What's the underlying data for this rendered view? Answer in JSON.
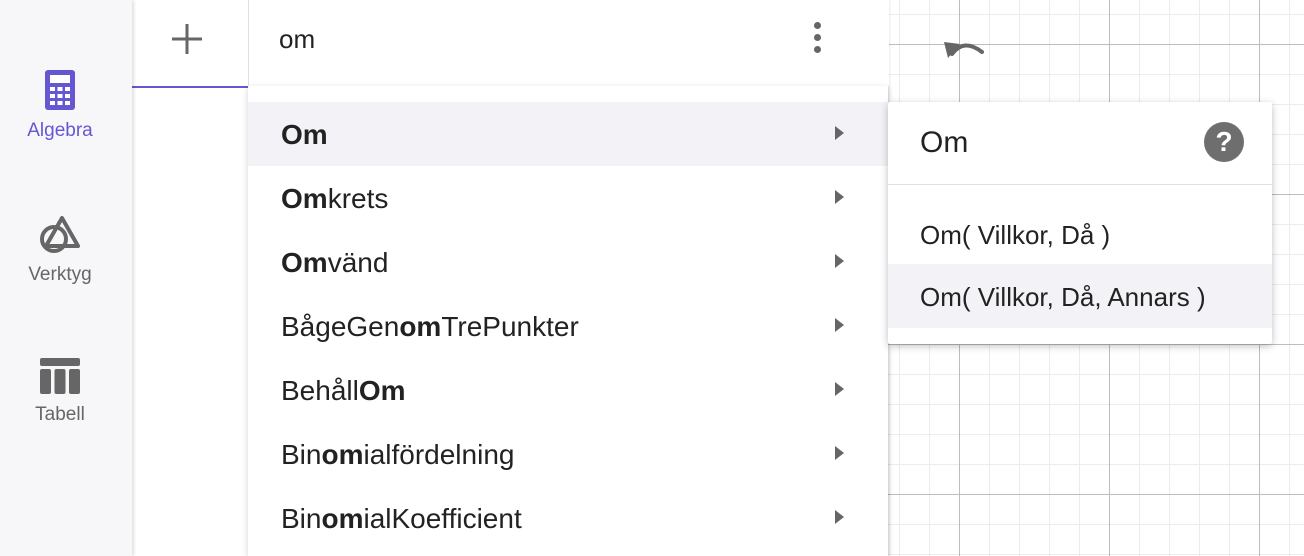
{
  "sidenav": {
    "items": [
      {
        "label": "Algebra",
        "icon": "calculator-icon",
        "active": true
      },
      {
        "label": "Verktyg",
        "icon": "shapes-icon",
        "active": false
      },
      {
        "label": "Tabell",
        "icon": "table-icon",
        "active": false
      }
    ]
  },
  "algebra": {
    "input_value": "om",
    "add_icon": "plus-icon",
    "menu_icon": "kebab-icon"
  },
  "suggestions": [
    {
      "pre": "",
      "match": "Om",
      "post": "",
      "active": true
    },
    {
      "pre": "",
      "match": "Om",
      "post": "krets",
      "active": false
    },
    {
      "pre": "",
      "match": "Om",
      "post": "vänd",
      "active": false
    },
    {
      "pre": "BågeGen",
      "match": "om",
      "post": "TrePunkter",
      "active": false
    },
    {
      "pre": "Behåll",
      "match": "Om",
      "post": "",
      "active": false
    },
    {
      "pre": "Bin",
      "match": "om",
      "post": "ialfördelning",
      "active": false
    },
    {
      "pre": "Bin",
      "match": "om",
      "post": "ialKoefficient",
      "active": false
    }
  ],
  "popup": {
    "title": "Om",
    "help_label": "?",
    "syntaxes": [
      {
        "label": "Om( Villkor, Då )",
        "active": false
      },
      {
        "label": "Om( Villkor, Då, Annars )",
        "active": true
      }
    ]
  },
  "colors": {
    "accent": "#6557d2",
    "icon_gray": "#666666"
  }
}
